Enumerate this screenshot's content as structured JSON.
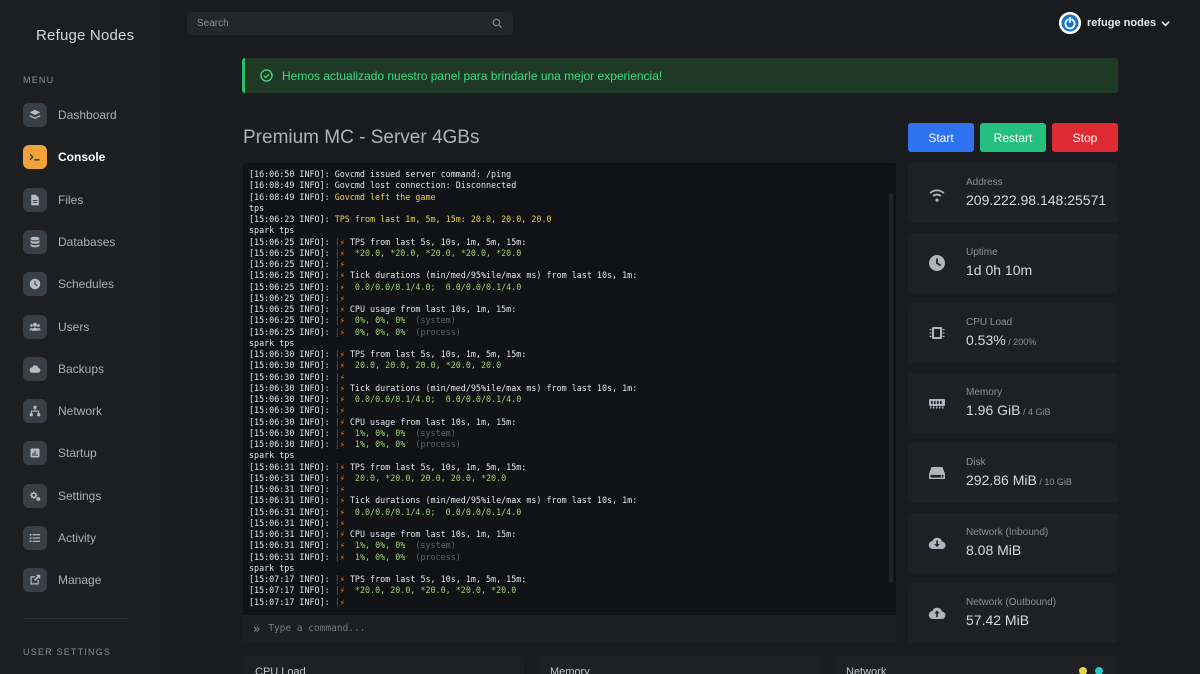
{
  "brand": "Refuge Nodes",
  "menu_label": "MENU",
  "nav": [
    {
      "label": "Dashboard",
      "icon": "layers-icon"
    },
    {
      "label": "Console",
      "icon": "terminal-icon",
      "active": true
    },
    {
      "label": "Files",
      "icon": "file-icon"
    },
    {
      "label": "Databases",
      "icon": "database-icon"
    },
    {
      "label": "Schedules",
      "icon": "clock-icon"
    },
    {
      "label": "Users",
      "icon": "users-icon"
    },
    {
      "label": "Backups",
      "icon": "cloud-icon"
    },
    {
      "label": "Network",
      "icon": "network-icon"
    },
    {
      "label": "Startup",
      "icon": "chart-icon"
    },
    {
      "label": "Settings",
      "icon": "cogs-icon"
    },
    {
      "label": "Activity",
      "icon": "list-icon"
    },
    {
      "label": "Manage",
      "icon": "external-link-icon"
    }
  ],
  "user_settings_label": "USER SETTINGS",
  "search": {
    "placeholder": "Search"
  },
  "user": {
    "name": "refuge nodes"
  },
  "alert": {
    "text": "Hemos actualizado nuestro panel para brindarle una mejor experiencia!",
    "color": "#3ddc7e"
  },
  "server": {
    "title": "Premium MC - Server 4GBs"
  },
  "buttons": {
    "start": "Start",
    "restart": "Restart",
    "stop": "Stop"
  },
  "colors": {
    "accent": "#f2a23a",
    "start": "#2f72f0",
    "restart": "#24c07f",
    "stop": "#e02a33"
  },
  "console": {
    "input_placeholder": "Type a command...",
    "lines": [
      {
        "p": "[16:06:50 INFO]: ",
        "t": "Govcmd issued server command: /ping",
        "c": ""
      },
      {
        "p": "[16:08:49 INFO]: ",
        "t": "Govcmd lost connection: Disconnected",
        "c": ""
      },
      {
        "p": "[16:08:49 INFO]: ",
        "t": "Govcmd left the game",
        "c": "y"
      },
      {
        "p": "",
        "t": "tps",
        "c": ""
      },
      {
        "p": "[15:06:23 INFO]: ",
        "t": "TPS from last 1m, 5m, 15m: 20.0, 20.0, 20.0",
        "c": "y"
      },
      {
        "p": "",
        "t": "spark tps",
        "c": ""
      },
      {
        "p": "[15:06:25 INFO]: ",
        "s": true,
        "t": "TPS from last 5s, 10s, 1m, 5m, 15m:",
        "c": ""
      },
      {
        "p": "[15:06:25 INFO]: ",
        "s": true,
        "t": " *20.0, *20.0, *20.0, *20.0, *20.0",
        "c": "g"
      },
      {
        "p": "[15:06:25 INFO]: ",
        "s": true,
        "t": "",
        "c": ""
      },
      {
        "p": "[15:06:25 INFO]: ",
        "s": true,
        "t": "Tick durations (min/med/95%ile/max ms) from last 10s, 1m:",
        "c": ""
      },
      {
        "p": "[15:06:25 INFO]: ",
        "s": true,
        "t": " 0.0/0.0/0.1/4.0;  0.0/0.0/0.1/4.0",
        "c": "g"
      },
      {
        "p": "[15:06:25 INFO]: ",
        "s": true,
        "t": "",
        "c": ""
      },
      {
        "p": "[15:06:25 INFO]: ",
        "s": true,
        "t": "CPU usage from last 10s, 1m, 15m:",
        "c": ""
      },
      {
        "p": "[15:06:25 INFO]: ",
        "s": true,
        "t": " 0%, 0%, 0%",
        "c": "g",
        "x": "  (system)"
      },
      {
        "p": "[15:06:25 INFO]: ",
        "s": true,
        "t": " 0%, 0%, 0%",
        "c": "g",
        "x": "  (process)"
      },
      {
        "p": "",
        "t": "spark tps",
        "c": ""
      },
      {
        "p": "[15:06:30 INFO]: ",
        "s": true,
        "t": "TPS from last 5s, 10s, 1m, 5m, 15m:",
        "c": ""
      },
      {
        "p": "[15:06:30 INFO]: ",
        "s": true,
        "t": " 20.0, 20.0, 20.0, *20.0, 20.0",
        "c": "g"
      },
      {
        "p": "[15:06:30 INFO]: ",
        "s": true,
        "t": "",
        "c": ""
      },
      {
        "p": "[15:06:30 INFO]: ",
        "s": true,
        "t": "Tick durations (min/med/95%ile/max ms) from last 10s, 1m:",
        "c": ""
      },
      {
        "p": "[15:06:30 INFO]: ",
        "s": true,
        "t": " 0.0/0.0/0.1/4.0;  0.0/0.0/0.1/4.0",
        "c": "g"
      },
      {
        "p": "[15:06:30 INFO]: ",
        "s": true,
        "t": "",
        "c": ""
      },
      {
        "p": "[15:06:30 INFO]: ",
        "s": true,
        "t": "CPU usage from last 10s, 1m, 15m:",
        "c": ""
      },
      {
        "p": "[15:06:30 INFO]: ",
        "s": true,
        "t": " 1%, 0%, 0%",
        "c": "g",
        "x": "  (system)"
      },
      {
        "p": "[15:06:30 INFO]: ",
        "s": true,
        "t": " 1%, 0%, 0%",
        "c": "g",
        "x": "  (process)"
      },
      {
        "p": "",
        "t": "spark tps",
        "c": ""
      },
      {
        "p": "[15:06:31 INFO]: ",
        "s": true,
        "t": "TPS from last 5s, 10s, 1m, 5m, 15m:",
        "c": ""
      },
      {
        "p": "[15:06:31 INFO]: ",
        "s": true,
        "t": " 20.0, *20.0, 20.0, 20.0, *20.0",
        "c": "g"
      },
      {
        "p": "[15:06:31 INFO]: ",
        "s": true,
        "t": "",
        "c": ""
      },
      {
        "p": "[15:06:31 INFO]: ",
        "s": true,
        "t": "Tick durations (min/med/95%ile/max ms) from last 10s, 1m:",
        "c": ""
      },
      {
        "p": "[15:06:31 INFO]: ",
        "s": true,
        "t": " 0.0/0.0/0.1/4.0;  0.0/0.0/0.1/4.0",
        "c": "g"
      },
      {
        "p": "[15:06:31 INFO]: ",
        "s": true,
        "t": "",
        "c": ""
      },
      {
        "p": "[15:06:31 INFO]: ",
        "s": true,
        "t": "CPU usage from last 10s, 1m, 15m:",
        "c": ""
      },
      {
        "p": "[15:06:31 INFO]: ",
        "s": true,
        "t": " 1%, 0%, 0%",
        "c": "g",
        "x": "  (system)"
      },
      {
        "p": "[15:06:31 INFO]: ",
        "s": true,
        "t": " 1%, 0%, 0%",
        "c": "g",
        "x": "  (process)"
      },
      {
        "p": "",
        "t": "spark tps",
        "c": ""
      },
      {
        "p": "[15:07:17 INFO]: ",
        "s": true,
        "t": "TPS from last 5s, 10s, 1m, 5m, 15m:",
        "c": ""
      },
      {
        "p": "[15:07:17 INFO]: ",
        "s": true,
        "t": " *20.0, 20.0, *20.0, *20.0, *20.0",
        "c": "g"
      },
      {
        "p": "[15:07:17 INFO]: ",
        "s": true,
        "t": "",
        "c": ""
      }
    ]
  },
  "stats": [
    {
      "label": "Address",
      "value": "209.222.98.148:25571",
      "sub": "",
      "icon": "wifi-icon"
    },
    {
      "label": "Uptime",
      "value": "1d 0h 10m",
      "sub": "",
      "icon": "clock-icon"
    },
    {
      "label": "CPU Load",
      "value": "0.53%",
      "sub": " / 200%",
      "icon": "cpu-icon"
    },
    {
      "label": "Memory",
      "value": "1.96 GiB",
      "sub": " / 4 GiB",
      "icon": "memory-icon"
    },
    {
      "label": "Disk",
      "value": "292.86 MiB",
      "sub": " / 10 GiB",
      "icon": "disk-icon"
    },
    {
      "label": "Network (Inbound)",
      "value": "8.08 MiB",
      "sub": "",
      "icon": "cloud-download-icon"
    },
    {
      "label": "Network (Outbound)",
      "value": "57.42 MiB",
      "sub": "",
      "icon": "cloud-upload-icon"
    }
  ],
  "graphs": [
    {
      "title": "CPU Load"
    },
    {
      "title": "Memory"
    },
    {
      "title": "Network"
    }
  ]
}
